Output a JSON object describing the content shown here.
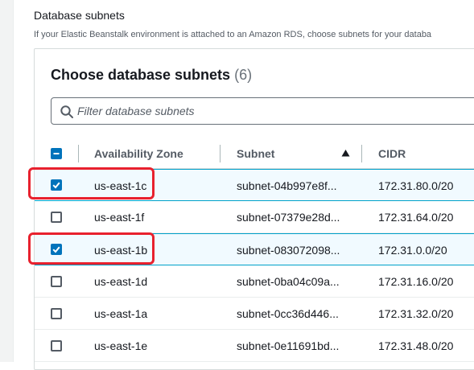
{
  "section": {
    "title": "Database subnets",
    "description": "If your Elastic Beanstalk environment is attached to an Amazon RDS, choose subnets for your databa"
  },
  "panel": {
    "title": "Choose database subnets",
    "count": "(6)"
  },
  "filter": {
    "placeholder": "Filter database subnets",
    "value": ""
  },
  "columns": {
    "availability_zone": "Availability Zone",
    "subnet": "Subnet",
    "cidr": "CIDR"
  },
  "rows": [
    {
      "az": "us-east-1c",
      "subnet": "subnet-04b997e8f...",
      "cidr": "172.31.80.0/20",
      "checked": true
    },
    {
      "az": "us-east-1f",
      "subnet": "subnet-07379e28d...",
      "cidr": "172.31.64.0/20",
      "checked": false
    },
    {
      "az": "us-east-1b",
      "subnet": "subnet-083072098...",
      "cidr": "172.31.0.0/20",
      "checked": true
    },
    {
      "az": "us-east-1d",
      "subnet": "subnet-0ba04c09a...",
      "cidr": "172.31.16.0/20",
      "checked": false
    },
    {
      "az": "us-east-1a",
      "subnet": "subnet-0cc36d446...",
      "cidr": "172.31.32.0/20",
      "checked": false
    },
    {
      "az": "us-east-1e",
      "subnet": "subnet-0e11691bd...",
      "cidr": "172.31.48.0/20",
      "checked": false
    }
  ],
  "header_checkbox": "indeterminate",
  "sort": {
    "column": "subnet",
    "direction": "ascending"
  },
  "colors": {
    "accent": "#0073bb",
    "highlight": "#e8212e"
  },
  "icons": {
    "search": "search-icon",
    "sort": "sort-ascending-icon"
  }
}
